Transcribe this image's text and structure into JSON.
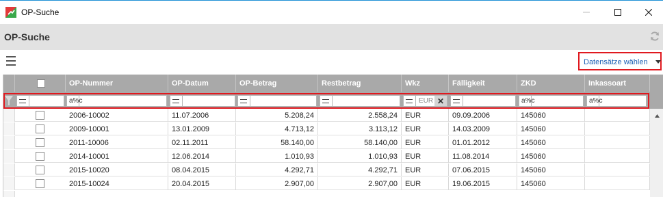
{
  "window": {
    "title": "OP-Suche",
    "minimize_icon": "minimize-icon",
    "maximize_icon": "maximize-icon",
    "close_icon": "close-icon"
  },
  "header": {
    "title": "OP-Suche",
    "refresh_icon": "refresh-icon"
  },
  "toolbar": {
    "menu_icon": "hamburger-menu-icon",
    "select_records_label": "Datensätze wählen"
  },
  "grid": {
    "columns": [
      "OP-Nummer",
      "OP-Datum",
      "OP-Betrag",
      "Restbetrag",
      "Wkz",
      "Fälligkeit",
      "ZKD",
      "Inkassoart"
    ],
    "filters": {
      "op_nummer": {
        "operator": "a%c",
        "value": ""
      },
      "op_datum": {
        "operator": "=",
        "value": ""
      },
      "op_betrag": {
        "operator": "=",
        "value": ""
      },
      "restbetrag": {
        "operator": "=",
        "value": ""
      },
      "wkz": {
        "operator": "=",
        "value": "EUR"
      },
      "faelligkeit": {
        "operator": "=",
        "value": ""
      },
      "zkd": {
        "operator": "a%c",
        "value": ""
      },
      "inkassoart": {
        "operator": "a%c",
        "value": ""
      }
    },
    "rows": [
      {
        "op_nummer": "2006-10002",
        "op_datum": "11.07.2006",
        "op_betrag": "5.208,24",
        "restbetrag": "2.558,24",
        "wkz": "EUR",
        "faelligkeit": "09.09.2006",
        "zkd": "145060",
        "inkassoart": ""
      },
      {
        "op_nummer": "2009-10001",
        "op_datum": "13.01.2009",
        "op_betrag": "4.713,12",
        "restbetrag": "3.113,12",
        "wkz": "EUR",
        "faelligkeit": "14.03.2009",
        "zkd": "145060",
        "inkassoart": ""
      },
      {
        "op_nummer": "2011-10006",
        "op_datum": "02.11.2011",
        "op_betrag": "58.140,00",
        "restbetrag": "58.140,00",
        "wkz": "EUR",
        "faelligkeit": "01.01.2012",
        "zkd": "145060",
        "inkassoart": ""
      },
      {
        "op_nummer": "2014-10001",
        "op_datum": "12.06.2014",
        "op_betrag": "1.010,93",
        "restbetrag": "1.010,93",
        "wkz": "EUR",
        "faelligkeit": "11.08.2014",
        "zkd": "145060",
        "inkassoart": ""
      },
      {
        "op_nummer": "2015-10020",
        "op_datum": "08.04.2015",
        "op_betrag": "4.292,71",
        "restbetrag": "4.292,71",
        "wkz": "EUR",
        "faelligkeit": "07.06.2015",
        "zkd": "145060",
        "inkassoart": ""
      },
      {
        "op_nummer": "2015-10024",
        "op_datum": "20.04.2015",
        "op_betrag": "2.907,00",
        "restbetrag": "2.907,00",
        "wkz": "EUR",
        "faelligkeit": "19.06.2015",
        "zkd": "145060",
        "inkassoart": ""
      }
    ]
  },
  "colors": {
    "highlight": "#e0191f",
    "link": "#1a5fb4",
    "header_bg": "#a9a9a9",
    "band_bg": "#e2e2e2"
  }
}
